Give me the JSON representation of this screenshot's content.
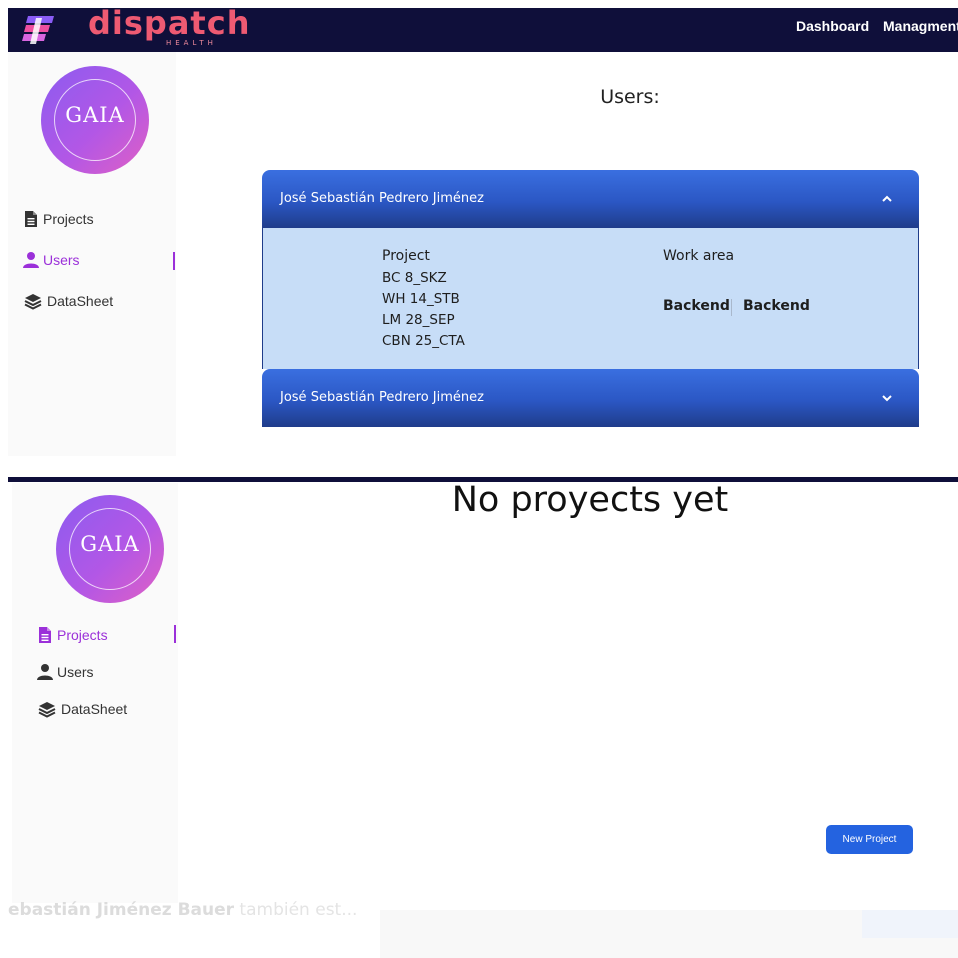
{
  "brand": {
    "name": "dispatch",
    "tagline": "HEALTH",
    "accent_color": "#ee5a72",
    "navbar_color": "#0f0f3a"
  },
  "navbar": {
    "links": [
      {
        "label": "Dashboard"
      },
      {
        "label": "Managment"
      }
    ]
  },
  "sidebar": {
    "avatar_text": "GAIA",
    "active_color": "#9b30d9",
    "items": [
      {
        "label": "Projects",
        "icon": "file-icon"
      },
      {
        "label": "Users",
        "icon": "user-icon"
      },
      {
        "label": "DataSheet",
        "icon": "layers-icon"
      }
    ]
  },
  "users_page": {
    "title": "Users:",
    "accordion": [
      {
        "name": "José Sebastián Pedrero Jiménez",
        "expanded": true,
        "project_header": "Project",
        "projects": [
          "BC 8_SKZ",
          "WH 14_STB",
          "LM 28_SEP",
          "CBN 25_CTA"
        ],
        "work_area_header": "Work area",
        "work_areas": [
          "Backend",
          "Backend"
        ]
      },
      {
        "name": "José Sebastián Pedrero Jiménez",
        "expanded": false
      }
    ]
  },
  "projects_page": {
    "empty_message": "No proyects yet",
    "new_button": "New Project"
  },
  "background_residue": {
    "text_bold": "ebastián Jiménez Bauer",
    "text_rest": " también est..."
  }
}
